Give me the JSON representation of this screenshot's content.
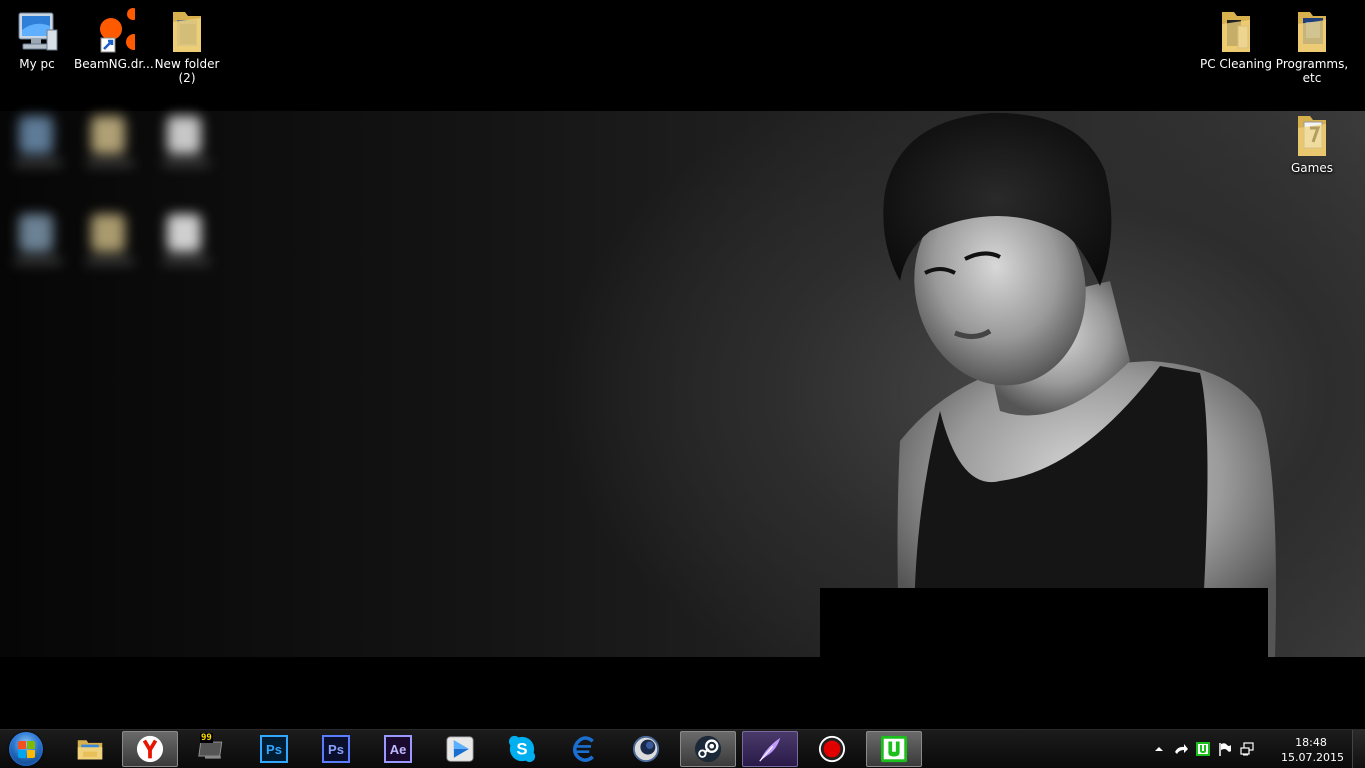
{
  "desktop_icons_left": [
    {
      "label": "My pc",
      "icon": "computer-icon"
    },
    {
      "label": "BeamNG.dr...",
      "icon": "beamng-icon"
    },
    {
      "label": "New folder (2)",
      "icon": "folder-icon"
    }
  ],
  "desktop_icons_right": [
    {
      "label": "PC Cleaning",
      "icon": "folder-icon"
    },
    {
      "label": "Programms, etc",
      "icon": "folder-icon"
    },
    {
      "label": "Games",
      "icon": "folder-icon"
    }
  ],
  "taskbar": {
    "start": {
      "icon": "windows-start-icon"
    },
    "pinned": [
      {
        "name": "file-explorer",
        "icon": "file-explorer-icon",
        "active": false
      },
      {
        "name": "yandex-browser",
        "icon": "yandex-icon",
        "active": true
      },
      {
        "name": "aimp",
        "icon": "aimp-icon",
        "active": false,
        "badge": "99"
      },
      {
        "name": "photoshop",
        "icon": "photoshop-icon",
        "text": "Ps",
        "active": false
      },
      {
        "name": "photoshop-2",
        "icon": "photoshop-icon",
        "text": "Ps",
        "active": false
      },
      {
        "name": "after-effects",
        "icon": "after-effects-icon",
        "text": "Ae",
        "active": false
      },
      {
        "name": "media-player",
        "icon": "media-player-icon",
        "active": false
      },
      {
        "name": "skype",
        "icon": "skype-icon",
        "active": false
      },
      {
        "name": "app-e",
        "icon": "e-logo-icon",
        "active": false
      },
      {
        "name": "cinema4d",
        "icon": "cinema4d-icon",
        "active": false
      },
      {
        "name": "steam",
        "icon": "steam-icon",
        "active": true
      },
      {
        "name": "feather-app",
        "icon": "feather-icon",
        "active": true
      },
      {
        "name": "recorder",
        "icon": "record-icon",
        "active": false
      },
      {
        "name": "utorrent",
        "icon": "utorrent-icon",
        "active": true
      }
    ],
    "tray": {
      "icons": [
        "show-hidden-icon",
        "network-arrow-icon",
        "utorrent-tray-icon",
        "action-center-flag-icon",
        "network-icon"
      ],
      "time": "18:48",
      "date": "15.07.2015"
    }
  },
  "colors": {
    "taskbar_bg": "#111111",
    "folder": "#e8c36a",
    "adobe_ps": "#31a8ff",
    "adobe_ps2": "#5a7cff",
    "adobe_ae": "#9999ff"
  }
}
